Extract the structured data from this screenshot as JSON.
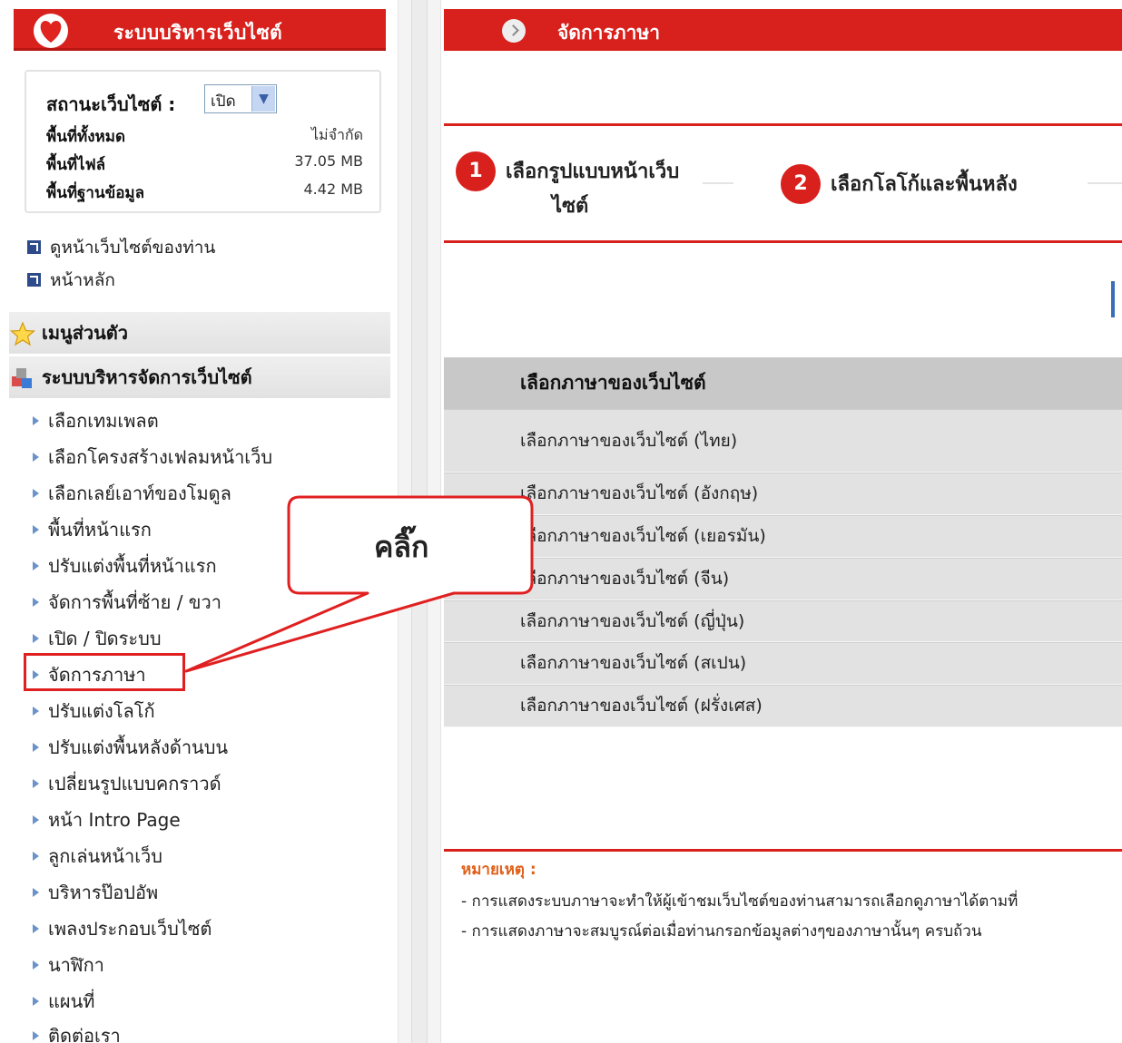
{
  "sidebar": {
    "header_title": "ระบบบริหารเว็บไซต์",
    "status": {
      "label": "สถานะเว็บไซต์ :",
      "selected": "เปิด",
      "rows": [
        {
          "label": "พื้นที่ทั้งหมด",
          "value": "ไม่จำกัด"
        },
        {
          "label": "พื้นที่ไฟล์",
          "value": "37.05 MB"
        },
        {
          "label": "พื้นที่ฐานข้อมูล",
          "value": "4.42 MB"
        }
      ]
    },
    "quick_links": [
      "ดูหน้าเว็บไซต์ของท่าน",
      "หน้าหลัก"
    ],
    "personal_menu": "เมนูส่วนตัว",
    "admin_menu": "ระบบบริหารจัดการเว็บไซต์",
    "menu_items": [
      "เลือกเทมเพลต",
      "เลือกโครงสร้างเฟลมหน้าเว็บ",
      "เลือกเลย์เอาท์ของโมดูล",
      "พื้นที่หน้าแรก",
      "ปรับแต่งพื้นที่หน้าแรก",
      "จัดการพื้นที่ซ้าย / ขวา",
      "เปิด / ปิดระบบ",
      "จัดการภาษา",
      "ปรับแต่งโลโก้",
      "ปรับแต่งพื้นหลังด้านบน",
      "เปลี่ยนรูปแบบคกราวด์",
      "หน้า Intro Page",
      "ลูกเล่นหน้าเว็บ",
      "บริหารป๊อปอัพ",
      "เพลงประกอบเว็บไซต์",
      "นาฬิกา",
      "แผนที่",
      "ติดต่อเรา"
    ]
  },
  "main": {
    "header_title": "จัดการภาษา",
    "steps": [
      {
        "num": "1",
        "label_line1": "เลือกรูปแบบหน้าเว็บ",
        "label_line2": "ไซต์"
      },
      {
        "num": "2",
        "label_line1": "เลือกโลโก้และพื้นหลัง"
      }
    ],
    "table": {
      "heading": "เลือกภาษาของเว็บไซต์",
      "rows": [
        "เลือกภาษาของเว็บไซต์ (ไทย)",
        "เลือกภาษาของเว็บไซต์ (อังกฤษ)",
        "เลือกภาษาของเว็บไซต์ (เยอรมัน)",
        "เลือกภาษาของเว็บไซต์ (จีน)",
        "เลือกภาษาของเว็บไซต์ (ญี่ปุ่น)",
        "เลือกภาษาของเว็บไซต์ (สเปน)",
        "เลือกภาษาของเว็บไซต์ (ฝรั่งเศส)"
      ]
    },
    "note": {
      "title": "หมายเหตุ :",
      "lines": [
        "- การแสดงระบบภาษาจะทำให้ผู้เข้าชมเว็บไซต์ของท่านสามารถเลือกดูภาษาได้ตามที่",
        "- การแสดงภาษาจะสมบูรณ์ต่อเมื่อท่านกรอกข้อมูลต่างๆของภาษานั้นๆ ครบถ้วน"
      ]
    }
  },
  "callout": {
    "text": "คลิ๊ก"
  },
  "colors": {
    "red": "#d8201c",
    "orange": "#e0601a",
    "row_gray": "#e2e2e2"
  }
}
